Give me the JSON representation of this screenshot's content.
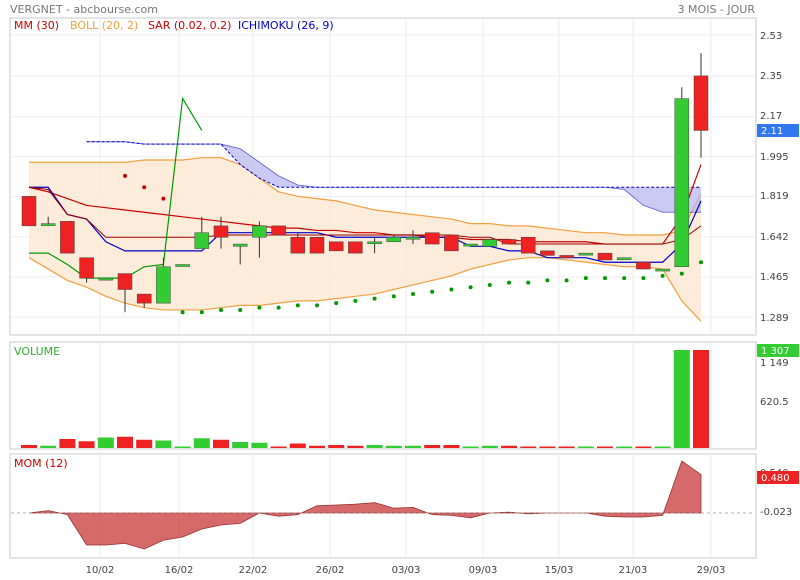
{
  "header": {
    "title": "VERGNET - abcbourse.com",
    "period": "3 MOIS - JOUR"
  },
  "legend": {
    "mm": "MM (30)",
    "boll": "BOLL (20, 2)",
    "sar": "SAR (0.02, 0.2)",
    "ichimoku": "ICHIMOKU (26, 9)"
  },
  "colors": {
    "up": "#33cc33",
    "down": "#ee2222",
    "mm": "#cc0000",
    "boll": "#f0a040",
    "boll_fill": "#fde9d2",
    "sar": "#009900",
    "ichimoku": "#0000cc",
    "cloud": "#b3b3ee",
    "mom_fill": "#cc4444",
    "last_price_bg": "#3377ee"
  },
  "price_axis": {
    "ticks": [
      "2.53",
      "2.35",
      "2.17",
      "1.995",
      "1.819",
      "1.642",
      "1.465",
      "1.289"
    ],
    "last_price": "2.11"
  },
  "volume_panel": {
    "label": "VOLUME",
    "ticks": [
      "1 149",
      "620.5"
    ],
    "last_value": "1 307"
  },
  "mom_panel": {
    "label": "MOM (12)",
    "ticks": [
      "0.540",
      "-0.023"
    ],
    "last_value": "0.480"
  },
  "x_axis": {
    "labels": [
      "10/02",
      "16/02",
      "22/02",
      "26/02",
      "03/03",
      "09/03",
      "15/03",
      "21/03",
      "29/03"
    ]
  },
  "chart_data": {
    "type": "candlestick",
    "ohlc": [
      {
        "open": 1.82,
        "high": 1.82,
        "low": 1.69,
        "close": 1.69
      },
      {
        "open": 1.7,
        "high": 1.73,
        "low": 1.69,
        "close": 1.7
      },
      {
        "open": 1.71,
        "high": 1.71,
        "low": 1.57,
        "close": 1.57
      },
      {
        "open": 1.55,
        "high": 1.55,
        "low": 1.44,
        "close": 1.46
      },
      {
        "open": 1.46,
        "high": 1.46,
        "low": 1.46,
        "close": 1.46
      },
      {
        "open": 1.48,
        "high": 1.48,
        "low": 1.31,
        "close": 1.41
      },
      {
        "open": 1.39,
        "high": 1.39,
        "low": 1.33,
        "close": 1.35
      },
      {
        "open": 1.35,
        "high": 1.55,
        "low": 1.35,
        "close": 1.51
      },
      {
        "open": 1.52,
        "high": 1.52,
        "low": 1.52,
        "close": 1.52
      },
      {
        "open": 1.59,
        "high": 1.73,
        "low": 1.59,
        "close": 1.66
      },
      {
        "open": 1.69,
        "high": 1.73,
        "low": 1.59,
        "close": 1.64
      },
      {
        "open": 1.6,
        "high": 1.61,
        "low": 1.52,
        "close": 1.61
      },
      {
        "open": 1.64,
        "high": 1.71,
        "low": 1.55,
        "close": 1.69
      },
      {
        "open": 1.69,
        "high": 1.69,
        "low": 1.65,
        "close": 1.65
      },
      {
        "open": 1.64,
        "high": 1.66,
        "low": 1.57,
        "close": 1.57
      },
      {
        "open": 1.64,
        "high": 1.64,
        "low": 1.57,
        "close": 1.57
      },
      {
        "open": 1.62,
        "high": 1.62,
        "low": 1.58,
        "close": 1.58
      },
      {
        "open": 1.62,
        "high": 1.62,
        "low": 1.57,
        "close": 1.57
      },
      {
        "open": 1.62,
        "high": 1.64,
        "low": 1.57,
        "close": 1.62
      },
      {
        "open": 1.62,
        "high": 1.65,
        "low": 1.62,
        "close": 1.64
      },
      {
        "open": 1.64,
        "high": 1.67,
        "low": 1.61,
        "close": 1.64
      },
      {
        "open": 1.66,
        "high": 1.66,
        "low": 1.61,
        "close": 1.61
      },
      {
        "open": 1.65,
        "high": 1.65,
        "low": 1.58,
        "close": 1.58
      },
      {
        "open": 1.61,
        "high": 1.61,
        "low": 1.61,
        "close": 1.61
      },
      {
        "open": 1.6,
        "high": 1.63,
        "low": 1.6,
        "close": 1.63
      },
      {
        "open": 1.63,
        "high": 1.63,
        "low": 1.61,
        "close": 1.61
      },
      {
        "open": 1.64,
        "high": 1.64,
        "low": 1.57,
        "close": 1.57
      },
      {
        "open": 1.58,
        "high": 1.58,
        "low": 1.56,
        "close": 1.56
      },
      {
        "open": 1.56,
        "high": 1.56,
        "low": 1.55,
        "close": 1.55
      },
      {
        "open": 1.57,
        "high": 1.57,
        "low": 1.57,
        "close": 1.57
      },
      {
        "open": 1.57,
        "high": 1.57,
        "low": 1.54,
        "close": 1.54
      },
      {
        "open": 1.55,
        "high": 1.55,
        "low": 1.55,
        "close": 1.55
      },
      {
        "open": 1.53,
        "high": 1.53,
        "low": 1.5,
        "close": 1.5
      },
      {
        "open": 1.5,
        "high": 1.5,
        "low": 1.5,
        "close": 1.5
      },
      {
        "open": 1.51,
        "high": 2.3,
        "low": 1.51,
        "close": 2.25
      },
      {
        "open": 2.35,
        "high": 2.45,
        "low": 1.99,
        "close": 2.11
      }
    ],
    "mm30": [
      1.86,
      1.84,
      1.81,
      1.78,
      1.77,
      1.76,
      1.75,
      1.74,
      1.73,
      1.72,
      1.71,
      1.7,
      1.69,
      1.68,
      1.68,
      1.67,
      1.67,
      1.66,
      1.66,
      1.65,
      1.65,
      1.64,
      1.64,
      1.63,
      1.63,
      1.63,
      1.62,
      1.62,
      1.62,
      1.62,
      1.61,
      1.61,
      1.61,
      1.61,
      1.73,
      1.96
    ],
    "boll_upper": [
      1.97,
      1.97,
      1.97,
      1.97,
      1.97,
      1.97,
      1.98,
      1.98,
      1.98,
      1.99,
      1.99,
      1.96,
      1.9,
      1.84,
      1.82,
      1.81,
      1.8,
      1.78,
      1.76,
      1.75,
      1.74,
      1.73,
      1.72,
      1.7,
      1.7,
      1.69,
      1.69,
      1.68,
      1.67,
      1.66,
      1.66,
      1.65,
      1.65,
      1.65,
      1.67,
      1.83
    ],
    "boll_lower": [
      1.55,
      1.5,
      1.45,
      1.42,
      1.38,
      1.35,
      1.33,
      1.32,
      1.32,
      1.32,
      1.33,
      1.34,
      1.34,
      1.35,
      1.36,
      1.36,
      1.37,
      1.38,
      1.39,
      1.41,
      1.43,
      1.45,
      1.47,
      1.5,
      1.52,
      1.54,
      1.55,
      1.55,
      1.54,
      1.53,
      1.52,
      1.51,
      1.51,
      1.5,
      1.36,
      1.27
    ],
    "sar": [
      null,
      null,
      null,
      null,
      null,
      1.91,
      1.86,
      1.81,
      1.31,
      1.31,
      1.32,
      1.32,
      1.33,
      1.33,
      1.34,
      1.34,
      1.35,
      1.36,
      1.37,
      1.38,
      1.39,
      1.4,
      1.41,
      1.42,
      1.43,
      1.44,
      1.44,
      1.45,
      1.45,
      1.46,
      1.46,
      1.46,
      1.46,
      1.47,
      1.48,
      1.53
    ],
    "ichimoku_tenkan": [
      1.86,
      1.86,
      1.74,
      1.72,
      1.62,
      1.58,
      1.58,
      1.58,
      1.58,
      1.58,
      1.66,
      1.66,
      1.66,
      1.66,
      1.66,
      1.66,
      1.64,
      1.64,
      1.64,
      1.64,
      1.64,
      1.64,
      1.64,
      1.6,
      1.6,
      1.58,
      1.58,
      1.55,
      1.55,
      1.55,
      1.53,
      1.53,
      1.53,
      1.53,
      1.61,
      1.8
    ],
    "ichimoku_kijun": [
      1.86,
      1.85,
      1.74,
      1.72,
      1.64,
      1.64,
      1.64,
      1.64,
      1.64,
      1.64,
      1.65,
      1.65,
      1.65,
      1.65,
      1.65,
      1.65,
      1.65,
      1.65,
      1.65,
      1.65,
      1.65,
      1.65,
      1.65,
      1.64,
      1.64,
      1.61,
      1.61,
      1.61,
      1.61,
      1.61,
      1.61,
      1.61,
      1.61,
      1.61,
      1.63,
      1.69
    ],
    "chikou": [
      1.57,
      1.57,
      1.52,
      1.46,
      1.46,
      1.46,
      1.51,
      1.52,
      2.25,
      2.11
    ],
    "ichimoku_cloud_a": [
      null,
      null,
      null,
      2.06,
      2.06,
      2.06,
      2.05,
      2.05,
      2.05,
      2.05,
      2.05,
      1.96,
      1.9,
      1.86,
      1.86,
      1.86,
      1.86,
      1.86,
      1.86,
      1.86,
      1.86,
      1.86,
      1.86,
      1.86,
      1.86,
      1.86,
      1.86,
      1.86,
      1.86,
      1.86,
      1.86,
      1.86,
      1.86,
      1.86,
      1.86,
      1.86
    ],
    "ichimoku_cloud_b": [
      null,
      null,
      null,
      2.06,
      2.06,
      2.06,
      2.05,
      2.05,
      2.05,
      2.05,
      2.05,
      2.03,
      1.97,
      1.91,
      1.87,
      1.86,
      1.86,
      1.86,
      1.86,
      1.86,
      1.86,
      1.86,
      1.86,
      1.86,
      1.86,
      1.86,
      1.86,
      1.86,
      1.86,
      1.86,
      1.86,
      1.85,
      1.78,
      1.75,
      1.75,
      1.75
    ],
    "volume": [
      40,
      30,
      120,
      90,
      140,
      150,
      110,
      100,
      20,
      130,
      110,
      80,
      70,
      20,
      60,
      30,
      40,
      30,
      40,
      30,
      30,
      40,
      40,
      20,
      30,
      30,
      20,
      20,
      20,
      20,
      20,
      20,
      20,
      20,
      1307,
      1307
    ],
    "volume_range": [
      0,
      1307
    ],
    "mom": [
      0.0,
      0.03,
      -0.02,
      -0.4,
      -0.4,
      -0.38,
      -0.45,
      -0.34,
      -0.3,
      -0.2,
      -0.15,
      -0.13,
      0.0,
      -0.04,
      -0.02,
      0.09,
      0.1,
      0.11,
      0.13,
      0.06,
      0.07,
      -0.02,
      -0.03,
      -0.06,
      0.0,
      0.01,
      -0.01,
      0.0,
      0.0,
      0.0,
      -0.04,
      -0.05,
      -0.05,
      -0.03,
      0.65,
      0.48
    ],
    "mom_range": [
      -0.55,
      0.7
    ],
    "ylim": [
      1.245,
      2.6
    ]
  }
}
